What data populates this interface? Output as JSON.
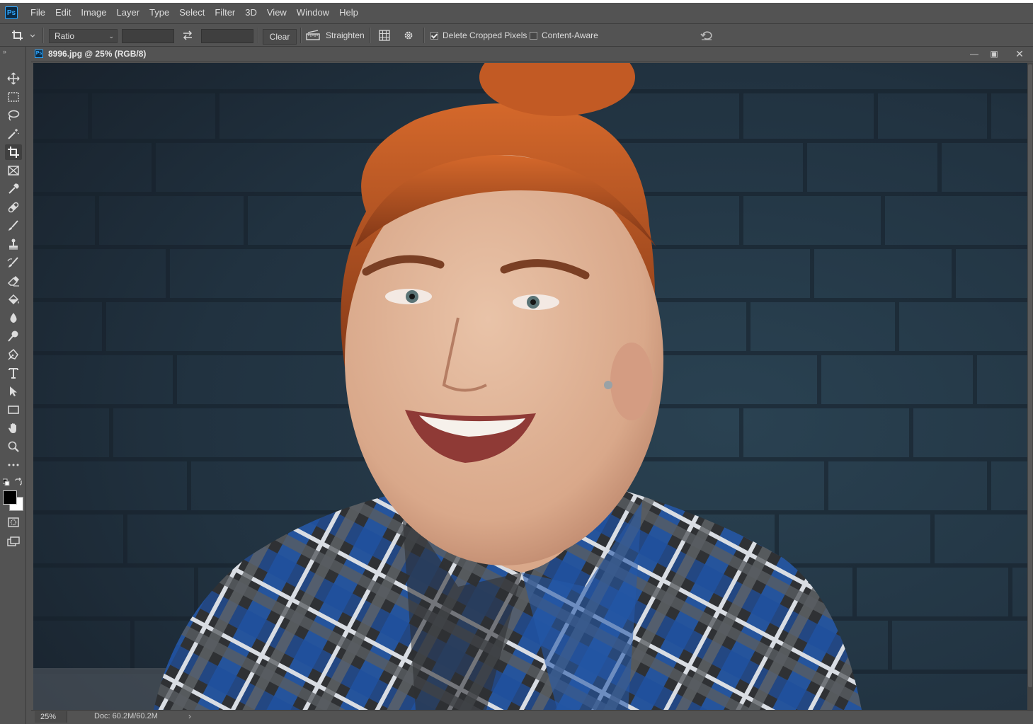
{
  "app": {
    "logo": "Ps"
  },
  "menu": [
    "File",
    "Edit",
    "Image",
    "Layer",
    "Type",
    "Select",
    "Filter",
    "3D",
    "View",
    "Window",
    "Help"
  ],
  "options": {
    "ratio_select": "Ratio",
    "width_value": "",
    "height_value": "",
    "clear_label": "Clear",
    "straighten_label": "Straighten",
    "delete_cropped_label": "Delete Cropped Pixels",
    "delete_cropped_checked": true,
    "content_aware_label": "Content-Aware",
    "content_aware_checked": false
  },
  "tools": [
    {
      "name": "move-tool",
      "icon": "move-icon"
    },
    {
      "name": "rectangular-marquee-tool",
      "icon": "marquee-icon"
    },
    {
      "name": "lasso-tool",
      "icon": "lasso-icon"
    },
    {
      "name": "magic-wand-tool",
      "icon": "magic-wand-icon"
    },
    {
      "name": "crop-tool",
      "icon": "crop-icon",
      "active": true
    },
    {
      "name": "frame-tool",
      "icon": "frame-icon"
    },
    {
      "name": "eyedropper-tool",
      "icon": "eyedropper-icon"
    },
    {
      "name": "healing-brush-tool",
      "icon": "bandage-icon"
    },
    {
      "name": "brush-tool",
      "icon": "brush-icon"
    },
    {
      "name": "clone-stamp-tool",
      "icon": "stamp-icon"
    },
    {
      "name": "history-brush-tool",
      "icon": "history-brush-icon"
    },
    {
      "name": "eraser-tool",
      "icon": "eraser-icon"
    },
    {
      "name": "paint-bucket-tool",
      "icon": "bucket-icon"
    },
    {
      "name": "blur-tool",
      "icon": "drop-icon"
    },
    {
      "name": "dodge-tool",
      "icon": "dodge-icon"
    },
    {
      "name": "pen-tool",
      "icon": "pen-icon"
    },
    {
      "name": "type-tool",
      "icon": "type-icon"
    },
    {
      "name": "path-selection-tool",
      "icon": "arrow-icon"
    },
    {
      "name": "rectangle-tool",
      "icon": "rectangle-icon"
    },
    {
      "name": "hand-tool",
      "icon": "hand-icon"
    },
    {
      "name": "zoom-tool",
      "icon": "zoom-icon"
    },
    {
      "name": "edit-toolbar",
      "icon": "more-icon"
    }
  ],
  "colors": {
    "foreground": "#000000",
    "background": "#ffffff",
    "accent": "#30a8ff"
  },
  "document": {
    "title": "8996.jpg @ 25% (RGB/8)"
  },
  "status": {
    "zoom": "25%",
    "doc_info": "Doc: 60.2M/60.2M",
    "arrow": "›"
  }
}
